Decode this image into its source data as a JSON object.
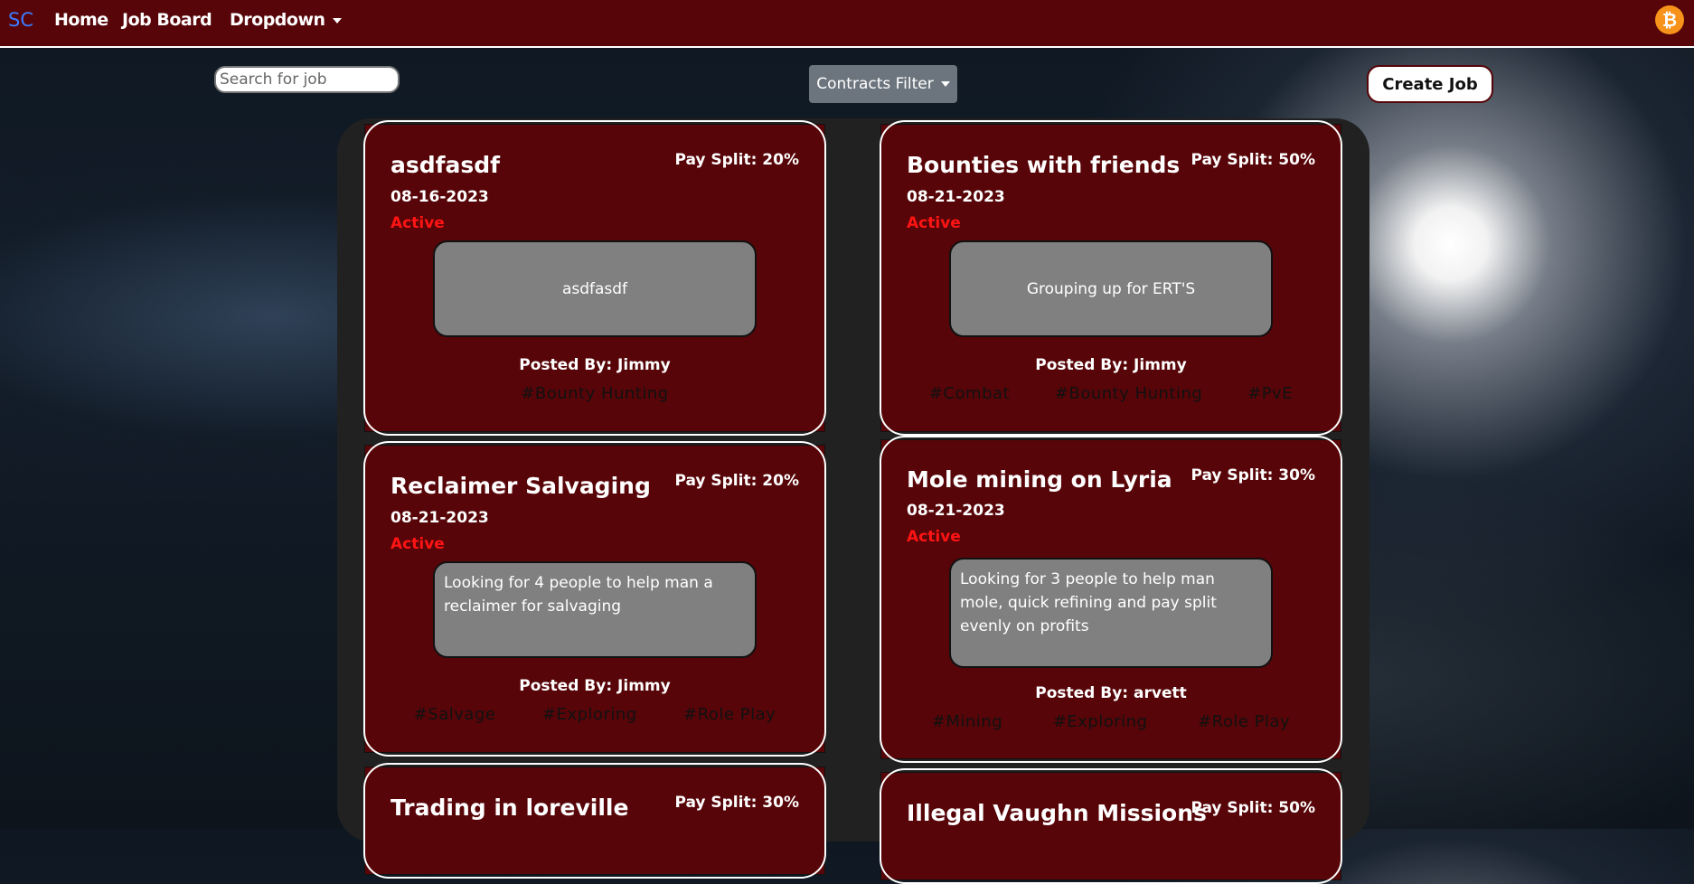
{
  "nav": {
    "brand": "SC",
    "home": "Home",
    "job_board": "Job Board",
    "dropdown": "Dropdown",
    "bitcoin_icon": "bitcoin-icon",
    "bitcoin_glyph": "₿"
  },
  "toolbar": {
    "search_placeholder": "Search for job",
    "filter_label": "Contracts Filter",
    "create_label": "Create Job"
  },
  "colors": {
    "navbar_bg": "#570508",
    "card_bg": "#570508",
    "status_active": "#ff1414",
    "filter_button": "#6c757d",
    "brand": "#3b7bff"
  },
  "jobs": [
    {
      "title": "asdfasdf",
      "pay": "Pay Split: 20%",
      "date": "08-16-2023",
      "status": "Active",
      "description": "asdfasdf",
      "posted_by": "Posted By: Jimmy",
      "tags": [
        "#Bounty Hunting"
      ]
    },
    {
      "title": "Bounties with friends",
      "pay": "Pay Split: 50%",
      "date": "08-21-2023",
      "status": "Active",
      "description": "Grouping up for ERT'S",
      "posted_by": "Posted By: Jimmy",
      "tags": [
        "#Combat",
        "#Bounty Hunting",
        "#PvE"
      ]
    },
    {
      "title": "Reclaimer Salvaging",
      "pay": "Pay Split: 20%",
      "date": "08-21-2023",
      "status": "Active",
      "description": "Looking for 4 people to help man a reclaimer for salvaging",
      "posted_by": "Posted By: Jimmy",
      "tags": [
        "#Salvage",
        "#Exploring",
        "#Role Play"
      ]
    },
    {
      "title": "Mole mining on Lyria",
      "pay": "Pay Split: 30%",
      "date": "08-21-2023",
      "status": "Active",
      "description": "Looking for 3 people to help man mole, quick refining and pay split evenly on profits",
      "posted_by": "Posted By: arvett",
      "tags": [
        "#Mining",
        "#Exploring",
        "#Role Play"
      ]
    },
    {
      "title": "Trading in loreville",
      "pay": "Pay Split: 30%"
    },
    {
      "title": "Illegal Vaughn Missions",
      "pay": "Pay Split: 50%"
    }
  ]
}
